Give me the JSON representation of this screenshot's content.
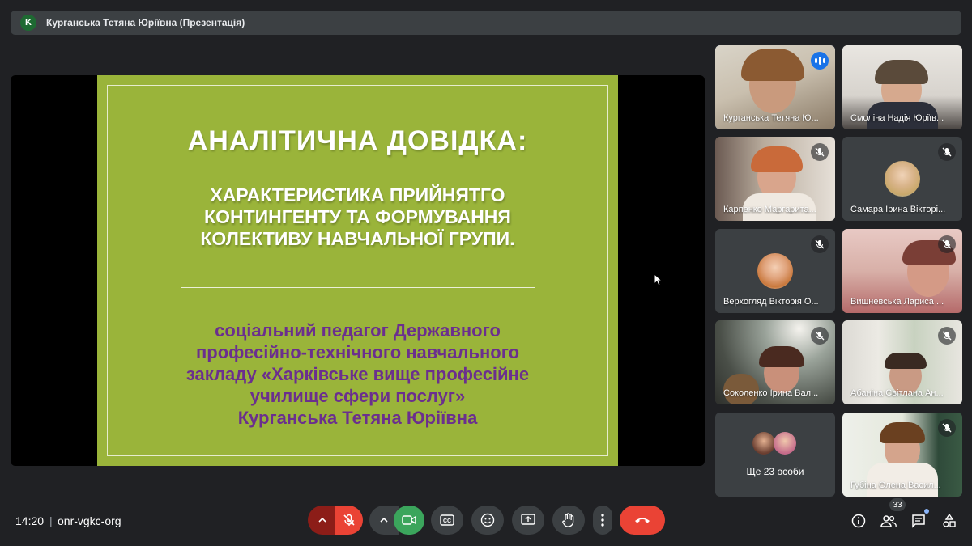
{
  "window": {
    "presenter_initial": "K",
    "title": "Курганська Тетяна Юріївна (Презентація)"
  },
  "slide": {
    "title": "АНАЛІТИЧНА ДОВІДКА:",
    "subtitle_lines": [
      "ХАРАКТЕРИСТИКА ПРИЙНЯТГО",
      "КОНТИНГЕНТУ ТА ФОРМУВАННЯ",
      "КОЛЕКТИВУ НАВЧАЛЬНОЇ ГРУПИ."
    ],
    "author_lines": [
      "соціальний педагог Державного",
      "професійно-технічного навчального",
      "закладу «Харківське вище професійне",
      "училище сфери послуг»",
      "Курганська Тетяна Юріївна"
    ],
    "colors": {
      "background": "#9ab43a",
      "title": "#ffffff",
      "author": "#6b2f8e"
    }
  },
  "participants": [
    {
      "name": "Курганська Тетяна Ю...",
      "speaking": true,
      "muted": false
    },
    {
      "name": "Смоліна Надія Юріїв...",
      "speaking": false,
      "muted": false
    },
    {
      "name": "Карпенко Маргарита...",
      "speaking": false,
      "muted": true
    },
    {
      "name": "Самара Ірина Вікторі...",
      "speaking": false,
      "muted": true
    },
    {
      "name": "Верхогляд Вікторія О...",
      "speaking": false,
      "muted": true
    },
    {
      "name": "Вишневська Лариса ...",
      "speaking": false,
      "muted": true
    },
    {
      "name": "Соколенко Ірина Вал...",
      "speaking": false,
      "muted": true
    },
    {
      "name": "Абаніна Світлана Ан...",
      "speaking": false,
      "muted": true
    },
    {
      "name": "Губіна Олена Васил...",
      "speaking": false,
      "muted": true
    }
  ],
  "more_participants": {
    "label": "Ще 23 особи"
  },
  "bottom_bar": {
    "time": "14:20",
    "separator": "|",
    "meeting_code": "onr-vgkc-org",
    "participants_count": "33"
  },
  "icons": {
    "mic_options": "chevron-up-icon",
    "mic": "mic-off-icon",
    "camera_options": "chevron-up-icon",
    "camera": "videocam-icon",
    "captions": "closed-caption-icon",
    "emoji": "emoji-icon",
    "present": "present-screen-icon",
    "raise_hand": "hand-icon",
    "more": "more-vert-icon",
    "leave": "call-end-icon",
    "info": "info-icon",
    "people": "people-icon",
    "chat": "chat-icon",
    "activities": "shapes-icon"
  }
}
